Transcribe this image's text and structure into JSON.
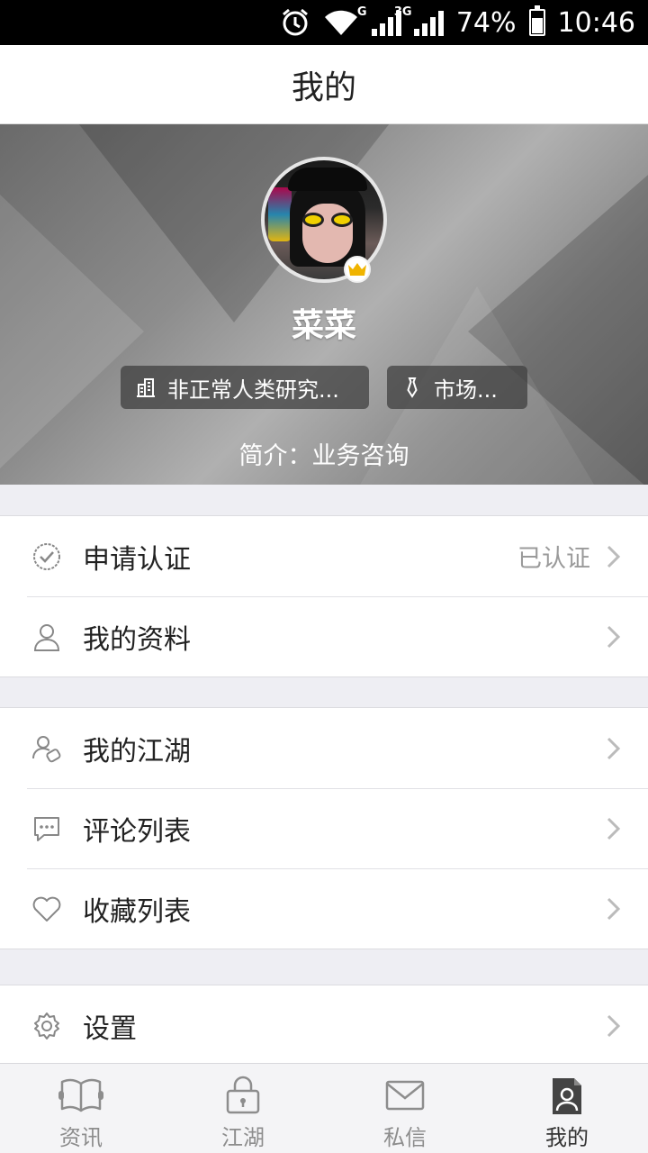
{
  "status_bar": {
    "battery": "74%",
    "battery_level": 0.74,
    "time": "10:46",
    "net1": "G",
    "net2": "3G"
  },
  "header": {
    "title": "我的"
  },
  "profile": {
    "name": "菜菜",
    "company": "非正常人类研究...",
    "position": "市场...",
    "bio": "简介：业务咨询"
  },
  "menu": {
    "certify": {
      "label": "申请认证",
      "value": "已认证"
    },
    "my_profile": {
      "label": "我的资料"
    },
    "my_jianghu": {
      "label": "我的江湖"
    },
    "comments": {
      "label": "评论列表"
    },
    "favorites": {
      "label": "收藏列表"
    },
    "settings": {
      "label": "设置"
    }
  },
  "tabs": [
    {
      "label": "资讯",
      "icon": "book-icon"
    },
    {
      "label": "江湖",
      "icon": "lock-icon"
    },
    {
      "label": "私信",
      "icon": "mail-icon"
    },
    {
      "label": "我的",
      "icon": "profile-card-icon"
    }
  ],
  "colors": {
    "accent_active_tab": "#333333",
    "inactive": "#8d8d8d",
    "crown": "#f0b400"
  }
}
